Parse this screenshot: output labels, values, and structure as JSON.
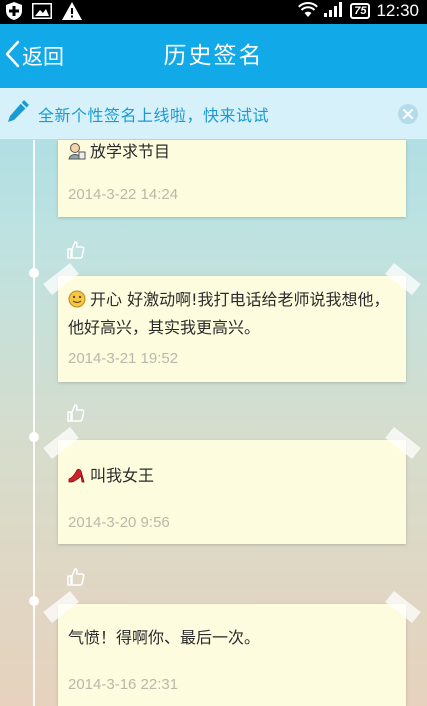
{
  "status_bar": {
    "battery": "75",
    "time": "12:30"
  },
  "header": {
    "back_label": "返回",
    "title": "历史签名"
  },
  "banner": {
    "text": "全新个性签名上线啦，快来试试"
  },
  "signatures": [
    {
      "icon": "student-emoji-icon",
      "text": "放学求节目",
      "date": "2014-3-22 14:24"
    },
    {
      "icon": "smile-emoji-icon",
      "text": "开心 好激动啊!我打电话给老师说我想他，他好高兴，其实我更高兴。",
      "date": "2014-3-21 19:52"
    },
    {
      "icon": "high-heel-emoji-icon",
      "text": "叫我女王",
      "date": "2014-3-20 9:56"
    },
    {
      "icon": "",
      "text": "气愤！得啊你、最后一次。",
      "date": "2014-3-16 22:31"
    }
  ],
  "colors": {
    "title_bar": "#12a9e8",
    "banner_bg": "#d6f1f9",
    "banner_text": "#1a9bd4",
    "card_bg": "#fdfcde"
  }
}
